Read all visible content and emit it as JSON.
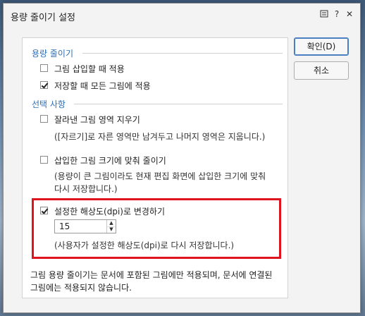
{
  "dialog": {
    "title": "용량 줄이기 설정",
    "icons": {
      "help": "help-icon",
      "question": "question-icon",
      "close": "close-icon"
    }
  },
  "section1": {
    "label": "용량 줄이기",
    "option1": {
      "label": "그림 삽입할 때 적용",
      "checked": false
    },
    "option2": {
      "label": "저장할 때 모든 그림에 적용",
      "checked": true
    }
  },
  "section2": {
    "label": "선택 사항",
    "crop": {
      "label": "잘라낸 그림 영역 지우기",
      "desc": "([자르기]로 자른 영역만 남겨두고 나머지 영역은 지웁니다.)",
      "checked": false
    },
    "resize": {
      "label": "삽입한 그림 크기에 맞춰 줄이기",
      "desc1": "(용량이 큰 그림이라도 현재 편집 화면에 삽입한 크기에 맞춰",
      "desc2": "다시 저장합니다.)",
      "checked": false
    },
    "dpi": {
      "label": "설정한 해상도(dpi)로 변경하기",
      "value": "15",
      "desc": "(사용자가 설정한 해상도(dpi)로 다시 저장합니다.)",
      "checked": true
    }
  },
  "footnote": {
    "line1": "그림 용량 줄이기는 문서에 포함된 그림에만 적용되며, 문서에 연결된",
    "line2": "그림에는 적용되지 않습니다."
  },
  "buttons": {
    "ok": "확인(D)",
    "cancel": "취소"
  },
  "colors": {
    "accent": "#2f6fb5",
    "highlight": "#e0141e"
  }
}
